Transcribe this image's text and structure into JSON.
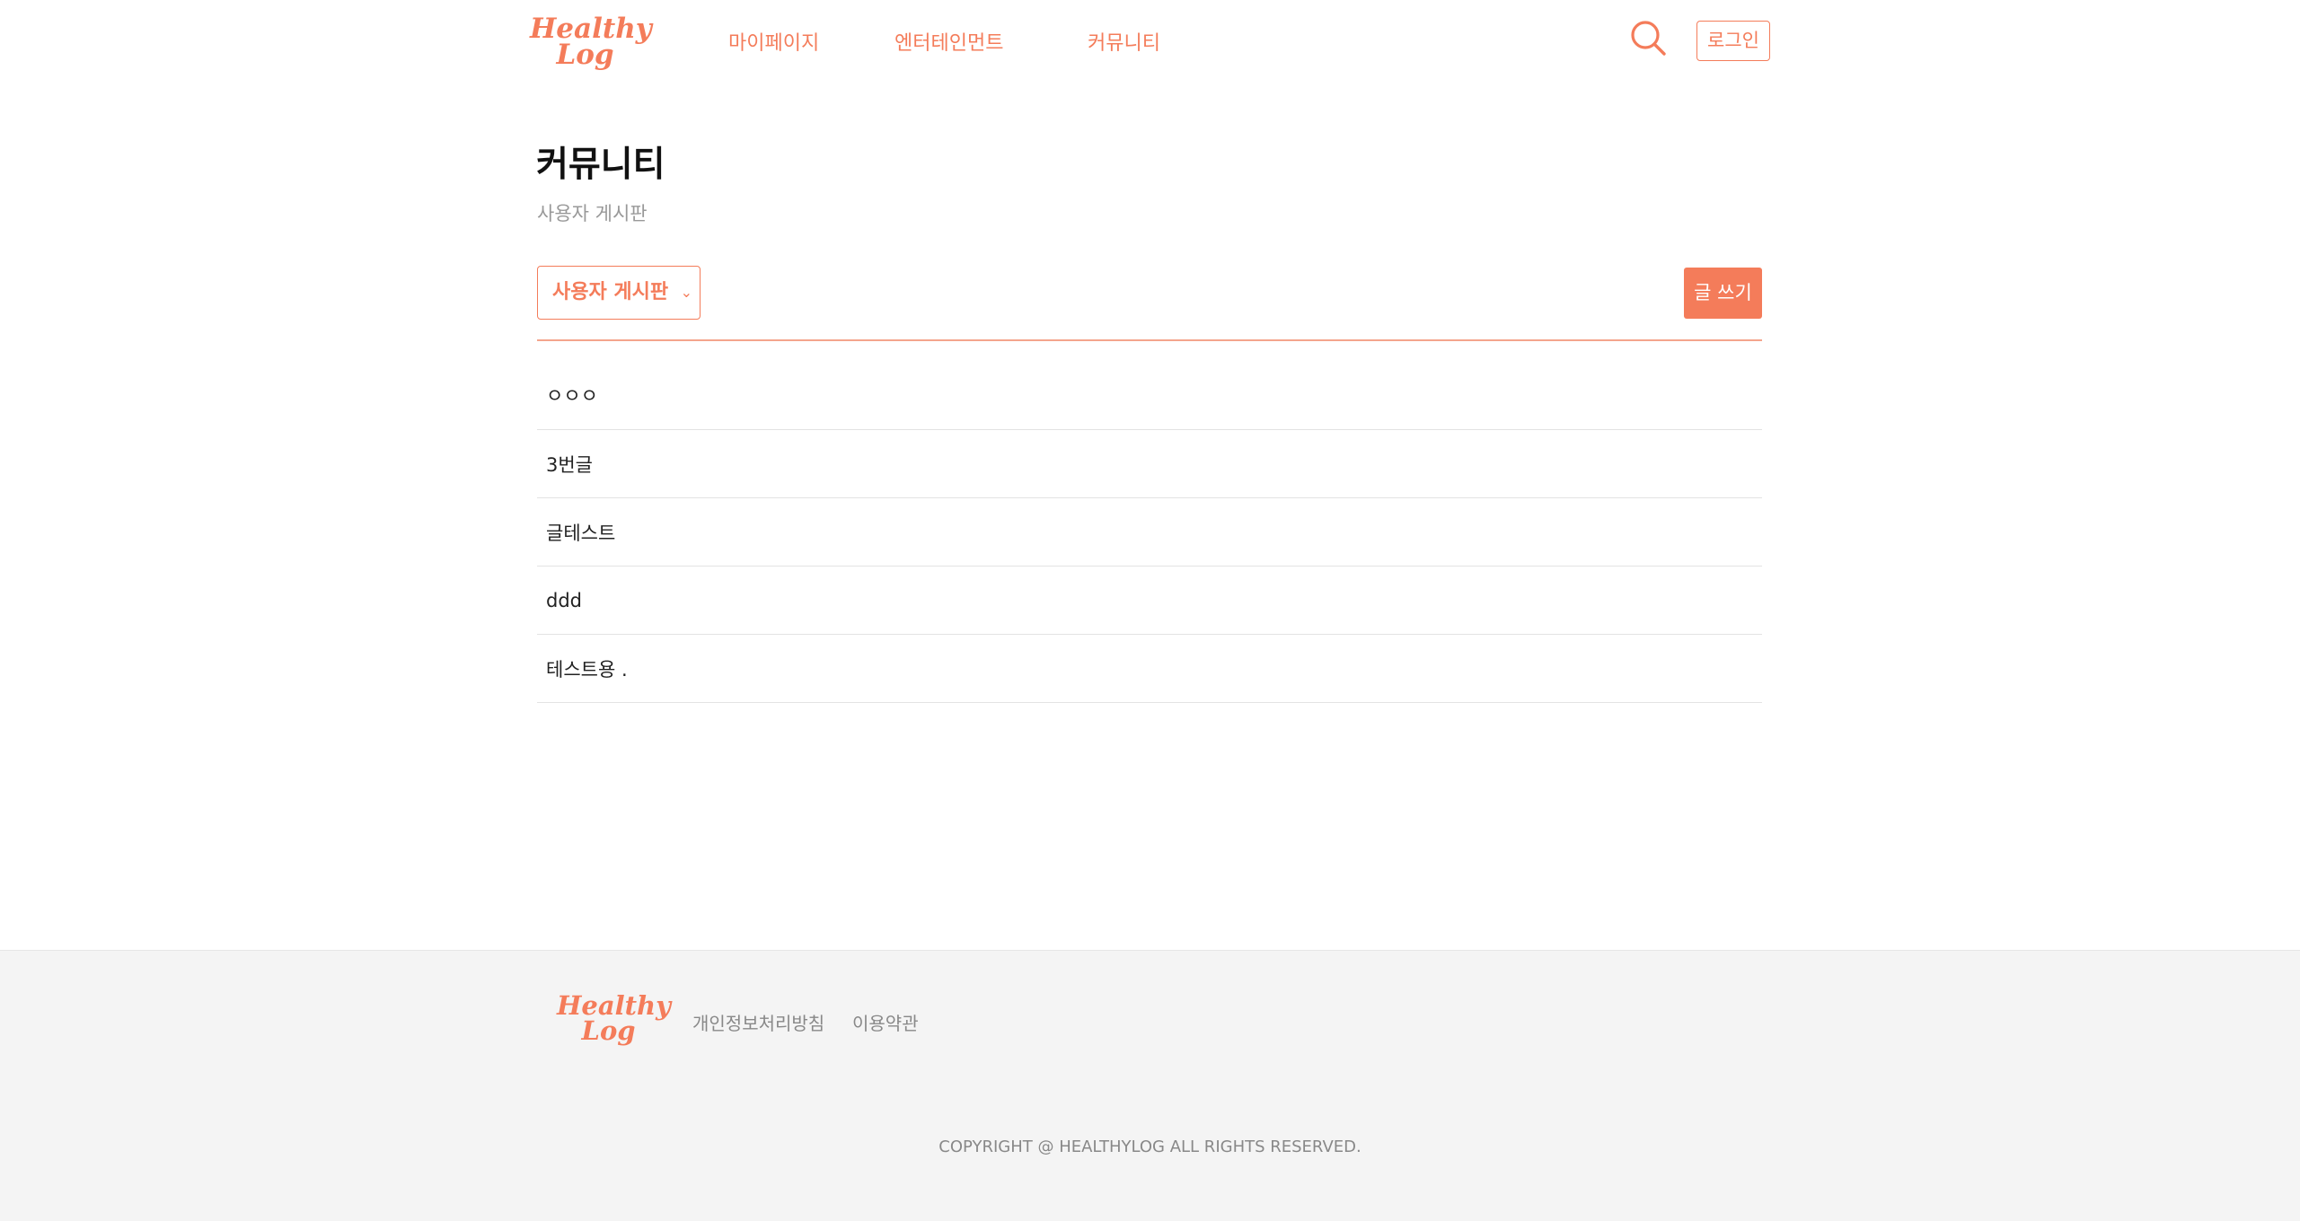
{
  "brand": {
    "logo_line1": "Healthy",
    "logo_line2": "Log",
    "accent": "#f47c5a"
  },
  "nav": {
    "items": [
      {
        "label": "마이페이지"
      },
      {
        "label": "엔터테인먼트"
      },
      {
        "label": "커뮤니티"
      }
    ],
    "search_icon": "search-icon",
    "login_label": "로그인"
  },
  "main": {
    "title": "커뮤니티",
    "subtitle": "사용자 게시판",
    "board_select": {
      "selected": "사용자 게시판",
      "chevron": "⌄"
    },
    "write_label": "글 쓰기",
    "posts": [
      {
        "title": "ㅇㅇㅇ"
      },
      {
        "title": "3번글"
      },
      {
        "title": "글테스트"
      },
      {
        "title": "ddd"
      },
      {
        "title": "테스트용 ."
      }
    ]
  },
  "footer": {
    "logo_line1": "Healthy",
    "logo_line2": "Log",
    "links": [
      {
        "label": "개인정보처리방침"
      },
      {
        "label": "이용약관"
      }
    ],
    "copyright": "COPYRIGHT @ HEALTHYLOG ALL RIGHTS RESERVED."
  }
}
